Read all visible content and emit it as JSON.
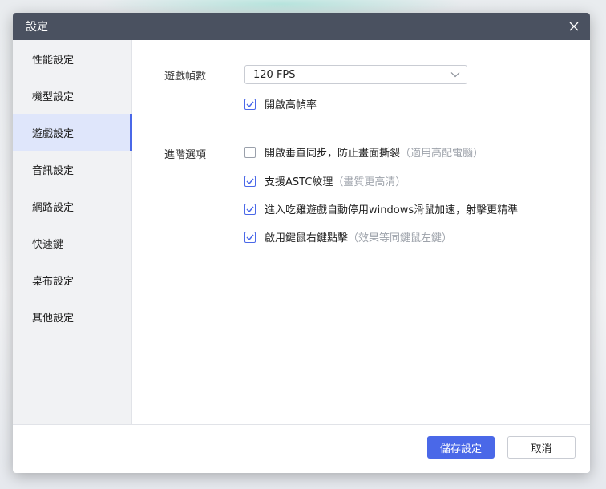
{
  "dialog": {
    "title": "設定"
  },
  "sidebar": {
    "items": [
      {
        "label": "性能設定",
        "active": false
      },
      {
        "label": "機型設定",
        "active": false
      },
      {
        "label": "遊戲設定",
        "active": true
      },
      {
        "label": "音訊設定",
        "active": false
      },
      {
        "label": "網路設定",
        "active": false
      },
      {
        "label": "快速鍵",
        "active": false
      },
      {
        "label": "桌布設定",
        "active": false
      },
      {
        "label": "其他設定",
        "active": false
      }
    ]
  },
  "game": {
    "fps_label": "遊戲幀數",
    "fps_value": "120 FPS",
    "high_fps": {
      "label": "開啟高幀率",
      "checked": true
    },
    "advanced_label": "進階選項",
    "options": [
      {
        "label": "開啟垂直同步，防止畫面撕裂",
        "hint": "（適用高配電腦）",
        "checked": false
      },
      {
        "label": "支援ASTC紋理",
        "hint": "（畫質更高清）",
        "checked": true
      },
      {
        "label": "進入吃雞遊戲自動停用windows滑鼠加速，射擊更精準",
        "hint": "",
        "checked": true
      },
      {
        "label": "啟用鍵鼠右鍵點擊",
        "hint": "（效果等同鍵鼠左鍵）",
        "checked": true
      }
    ]
  },
  "footer": {
    "save_label": "儲存設定",
    "cancel_label": "取消"
  },
  "colors": {
    "accent": "#4a68e8",
    "titlebar": "#4a5160",
    "sidebar_bg": "#f1f2f4",
    "active_bg": "#dfe6fb"
  },
  "icons": {
    "close": "close-icon",
    "dropdown": "chevron-down-icon",
    "check": "check-icon"
  }
}
